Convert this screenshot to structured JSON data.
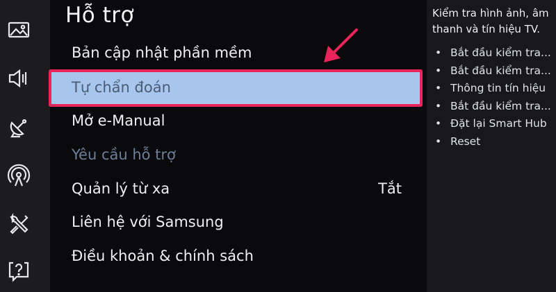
{
  "colors": {
    "sidebar_bg": "#1c1c1f",
    "menu_bg": "#0a0a0c",
    "highlight_fill": "#a7c5ed",
    "highlight_border": "#e8245a",
    "arrow": "#e8245a",
    "disabled_text": "#6e7f9a"
  },
  "sidebar": {
    "icons": [
      {
        "name": "picture-icon"
      },
      {
        "name": "sound-icon"
      },
      {
        "name": "broadcasting-icon"
      },
      {
        "name": "network-icon"
      },
      {
        "name": "tools-icon"
      },
      {
        "name": "support-icon"
      }
    ]
  },
  "menu": {
    "title": "Hỗ trợ",
    "items": [
      {
        "label": "Bản cập nhật phần mềm"
      },
      {
        "label": "Tự chẩn đoán",
        "selected": true
      },
      {
        "label": "Mở e-Manual"
      },
      {
        "label": "Yêu cầu hỗ trợ",
        "disabled": true
      },
      {
        "label": "Quản lý từ xa",
        "value": "Tắt"
      },
      {
        "label": "Liên hệ với Samsung"
      },
      {
        "label": "Điều khoản & chính sách"
      }
    ]
  },
  "info_panel": {
    "heading": "Kiểm tra hình ảnh, âm thanh và tín hiệu TV.",
    "bullets": [
      "Bắt đầu kiểm tra...",
      "Bắt đầu kiểm tra...",
      "Thông tin tín hiệu",
      "Bắt đầu kiểm tra...",
      "Đặt lại Smart Hub",
      "Reset"
    ]
  }
}
